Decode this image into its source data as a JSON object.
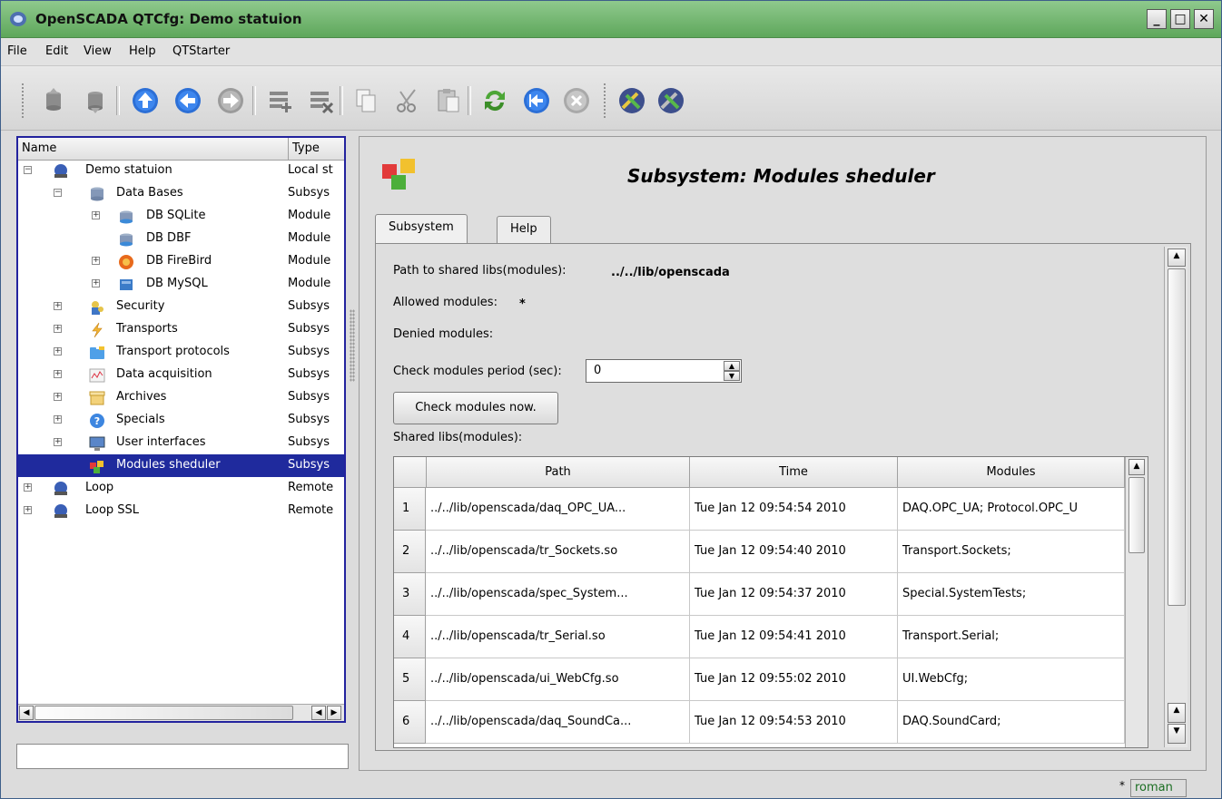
{
  "window": {
    "title": "OpenSCADA QTCfg: Demo statuion",
    "min_glyph": "_",
    "max_glyph": "□",
    "close_glyph": "✕"
  },
  "menu": [
    "File",
    "Edit",
    "View",
    "Help",
    "QTStarter"
  ],
  "toolbar": {
    "icons": [
      "db-load-icon",
      "db-save-icon",
      "up-icon",
      "back-icon",
      "forward-icon",
      "add-item-icon",
      "delete-item-icon",
      "copy-icon",
      "cut-icon",
      "paste-icon",
      "refresh-icon",
      "go-start-icon",
      "stop-icon",
      "qtcfg-module-icon",
      "qtcfg-module-icon-2"
    ]
  },
  "tree": {
    "col_name": "Name",
    "col_type": "Type",
    "rows": [
      {
        "label": "Demo statuion",
        "type": "Local st",
        "icon": "station-icon"
      },
      {
        "label": "Data Bases",
        "type": "Subsys",
        "icon": "database-icon"
      },
      {
        "label": "DB SQLite",
        "type": "Module",
        "icon": "db-sqlite-icon"
      },
      {
        "label": "DB DBF",
        "type": "Module",
        "icon": "db-dbf-icon"
      },
      {
        "label": "DB FireBird",
        "type": "Module",
        "icon": "db-firebird-icon"
      },
      {
        "label": "DB MySQL",
        "type": "Module",
        "icon": "db-mysql-icon"
      },
      {
        "label": "Security",
        "type": "Subsys",
        "icon": "security-icon"
      },
      {
        "label": "Transports",
        "type": "Subsys",
        "icon": "transports-icon"
      },
      {
        "label": "Transport protocols",
        "type": "Subsys",
        "icon": "protocols-icon"
      },
      {
        "label": "Data acquisition",
        "type": "Subsys",
        "icon": "acquisition-icon"
      },
      {
        "label": "Archives",
        "type": "Subsys",
        "icon": "archives-icon"
      },
      {
        "label": "Specials",
        "type": "Subsys",
        "icon": "specials-icon"
      },
      {
        "label": "User interfaces",
        "type": "Subsys",
        "icon": "ui-icon"
      },
      {
        "label": "Modules sheduler",
        "type": "Subsys",
        "icon": "modules-icon"
      },
      {
        "label": "Loop",
        "type": "Remote",
        "icon": "station-icon"
      },
      {
        "label": "Loop SSL",
        "type": "Remote",
        "icon": "station-icon"
      }
    ]
  },
  "page": {
    "title": "Subsystem: Modules sheduler",
    "tabs": [
      "Subsystem",
      "Help"
    ],
    "path_label": "Path to shared libs(modules):",
    "path_value": "../../lib/openscada",
    "allowed_label": "Allowed modules:",
    "allowed_value": "*",
    "denied_label": "Denied modules:",
    "period_label": "Check modules period (sec):",
    "period_value": "0",
    "check_button": "Check modules now.",
    "libs_label": "Shared libs(modules):"
  },
  "table": {
    "columns": [
      "Path",
      "Time",
      "Modules"
    ],
    "rows": [
      {
        "n": "1",
        "path": "../../lib/openscada/daq_OPC_UA...",
        "time": "Tue Jan 12 09:54:54 2010",
        "modules": "DAQ.OPC_UA; Protocol.OPC_U"
      },
      {
        "n": "2",
        "path": "../../lib/openscada/tr_Sockets.so",
        "time": "Tue Jan 12 09:54:40 2010",
        "modules": "Transport.Sockets;"
      },
      {
        "n": "3",
        "path": "../../lib/openscada/spec_System...",
        "time": "Tue Jan 12 09:54:37 2010",
        "modules": "Special.SystemTests;"
      },
      {
        "n": "4",
        "path": "../../lib/openscada/tr_Serial.so",
        "time": "Tue Jan 12 09:54:41 2010",
        "modules": "Transport.Serial;"
      },
      {
        "n": "5",
        "path": "../../lib/openscada/ui_WebCfg.so",
        "time": "Tue Jan 12 09:55:02 2010",
        "modules": "UI.WebCfg;"
      },
      {
        "n": "6",
        "path": "../../lib/openscada/daq_SoundCa...",
        "time": "Tue Jan 12 09:54:53 2010",
        "modules": "DAQ.SoundCard;"
      }
    ]
  },
  "status": {
    "marker": "*",
    "user": "roman"
  }
}
